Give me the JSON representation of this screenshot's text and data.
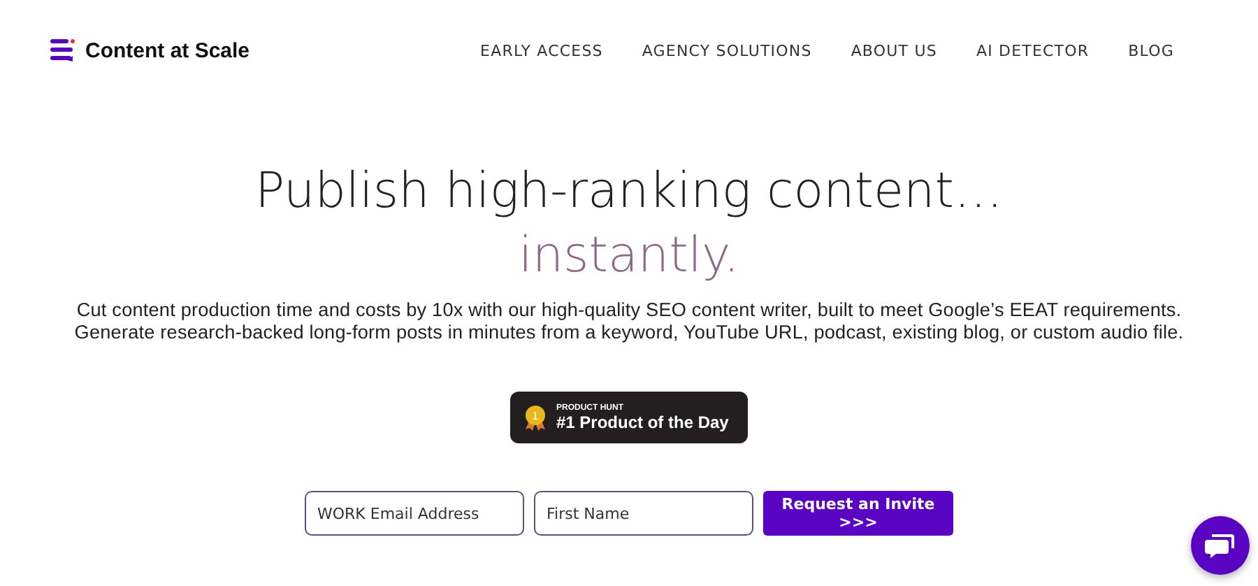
{
  "header": {
    "logo": "Content at Scale",
    "nav": [
      {
        "label": "EARLY ACCESS"
      },
      {
        "label": "AGENCY SOLUTIONS"
      },
      {
        "label": "ABOUT US"
      },
      {
        "label": "AI DETECTOR"
      },
      {
        "label": "BLOG"
      }
    ]
  },
  "hero": {
    "headline": "Publish high-ranking content…",
    "accent": "instantly.",
    "description": "Cut content production time and costs by 10x with our high-quality SEO content writer, built to meet Google’s EEAT requirements. Generate research-backed long-form posts in minutes from a keyword, YouTube URL, podcast, existing blog, or custom audio file.",
    "badge": {
      "medal_number": "1",
      "kicker": "PRODUCT HUNT",
      "title": "#1 Product of the Day"
    },
    "form": {
      "fields": [
        {
          "placeholder": "WORK Email Address"
        },
        {
          "placeholder": "First Name"
        }
      ],
      "button": "Request an Invite >>>"
    }
  }
}
